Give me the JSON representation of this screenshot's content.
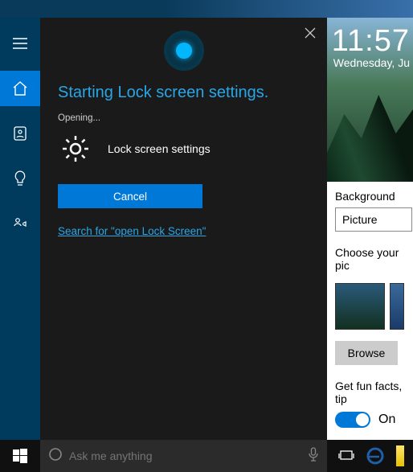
{
  "cortana": {
    "headline": "Starting Lock screen settings.",
    "opening": "Opening...",
    "item_label": "Lock screen settings",
    "cancel_label": "Cancel",
    "search_link": "Search for \"open Lock Screen\"",
    "searchbox_placeholder": "Ask me anything"
  },
  "sidebar": {
    "items": [
      {
        "name": "menu"
      },
      {
        "name": "home"
      },
      {
        "name": "notebook"
      },
      {
        "name": "tips"
      },
      {
        "name": "feedback"
      }
    ]
  },
  "settings": {
    "preview_time": "11:57",
    "preview_date": "Wednesday, Ju",
    "background_label": "Background",
    "background_value": "Picture",
    "choose_label": "Choose your pic",
    "browse_label": "Browse",
    "funfacts_label": "Get fun facts, tip",
    "toggle_state": "On"
  },
  "colors": {
    "accent": "#0078d7",
    "cortana_blue": "#2aa6e6"
  }
}
